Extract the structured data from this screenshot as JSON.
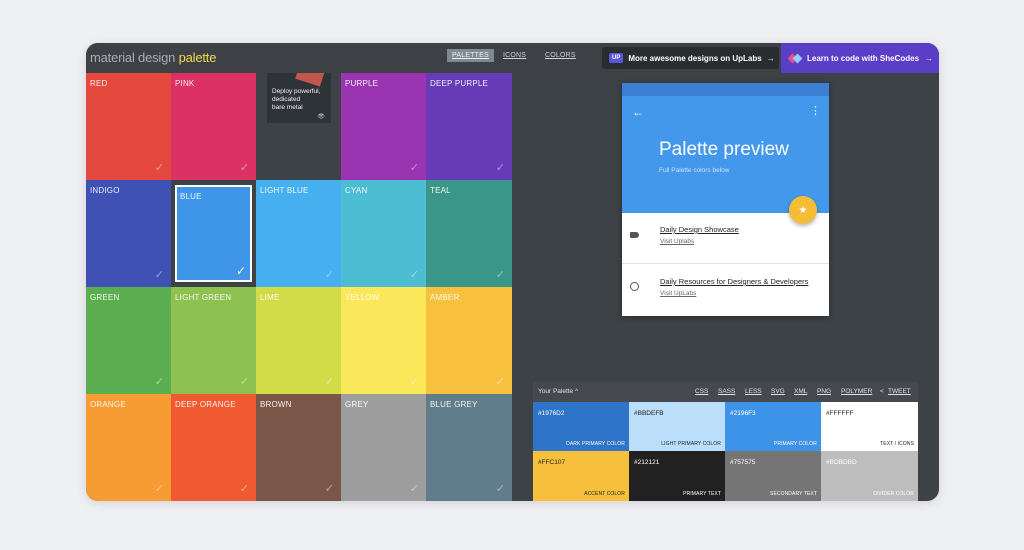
{
  "brand": {
    "part1": "material design",
    "part2": "palette"
  },
  "nav": {
    "palettes": "PALETTES",
    "icons": "ICONS",
    "colors": "COLORS"
  },
  "promo_uplabs": {
    "badge": "UP",
    "text": "More awesome designs on UpLabs",
    "arrow": "→"
  },
  "promo_shecodes": {
    "text": "Learn to code with SheCodes",
    "arrow": "→"
  },
  "ad": {
    "text_line1": "Deploy powerful,",
    "text_line2": "dedicated",
    "text_line3": "bare metal",
    "icon": "👁"
  },
  "check_glyph": "✓",
  "tiles": [
    {
      "label": "RED",
      "color": "#e5483c"
    },
    {
      "label": "PINK",
      "color": "#db3163"
    },
    {
      "label": "",
      "color": "#3d4246"
    },
    {
      "label": "PURPLE",
      "color": "#9a34b0"
    },
    {
      "label": "DEEP PURPLE",
      "color": "#673bb7"
    },
    {
      "label": "INDIGO",
      "color": "#3f51b5"
    },
    {
      "label": "BLUE",
      "color": "#3f96e9"
    },
    {
      "label": "LIGHT BLUE",
      "color": "#46aff0"
    },
    {
      "label": "CYAN",
      "color": "#4cbdd3"
    },
    {
      "label": "TEAL",
      "color": "#3a9688"
    },
    {
      "label": "GREEN",
      "color": "#5aae50"
    },
    {
      "label": "LIGHT GREEN",
      "color": "#8ec250"
    },
    {
      "label": "LIME",
      "color": "#d1dc48"
    },
    {
      "label": "YELLOW",
      "color": "#fae85a"
    },
    {
      "label": "AMBER",
      "color": "#f8c13d"
    },
    {
      "label": "ORANGE",
      "color": "#f79c33"
    },
    {
      "label": "DEEP ORANGE",
      "color": "#f15a30"
    },
    {
      "label": "BROWN",
      "color": "#7a5648"
    },
    {
      "label": "GREY",
      "color": "#9e9e9e"
    },
    {
      "label": "BLUE GREY",
      "color": "#617d8b"
    }
  ],
  "selected_tile": "BLUE",
  "preview": {
    "back_icon": "←",
    "more_icon": "⋮",
    "title": "Palette preview",
    "subtitle": "Full Palette colors below",
    "fab_icon": "★",
    "row1_title": "Daily Design Showcase",
    "row1_sub": "Visit Uplabs",
    "row2_title": "Daily Resources for Designers & Developers",
    "row2_sub": "Visit UpLabs"
  },
  "your_palette": {
    "title": "Your Palette ^",
    "formats": [
      "CSS",
      "SASS",
      "LESS",
      "SVG",
      "XML",
      "PNG",
      "POLYMER",
      "TWEET"
    ],
    "share_icon": "<",
    "swatches": [
      {
        "hex": "#1976D2",
        "role": "DARK PRIMARY COLOR",
        "bg": "#2e74c8",
        "fg": "#ffffff"
      },
      {
        "hex": "#BBDEFB",
        "role": "LIGHT PRIMARY COLOR",
        "bg": "#bbdefb",
        "fg": "#222222"
      },
      {
        "hex": "#2196F3",
        "role": "PRIMARY COLOR",
        "bg": "#3d93e8",
        "fg": "#ffffff"
      },
      {
        "hex": "#FFFFFF",
        "role": "TEXT / ICONS",
        "bg": "#ffffff",
        "fg": "#222222"
      },
      {
        "hex": "#FFC107",
        "role": "ACCENT COLOR",
        "bg": "#f7c03c",
        "fg": "#222222"
      },
      {
        "hex": "#212121",
        "role": "PRIMARY TEXT",
        "bg": "#212121",
        "fg": "#ffffff"
      },
      {
        "hex": "#757575",
        "role": "SECONDARY TEXT",
        "bg": "#757575",
        "fg": "#ffffff"
      },
      {
        "hex": "#BDBDBD",
        "role": "DIVIDER COLOR",
        "bg": "#bdbdbd",
        "fg": "#ffffff"
      }
    ]
  }
}
